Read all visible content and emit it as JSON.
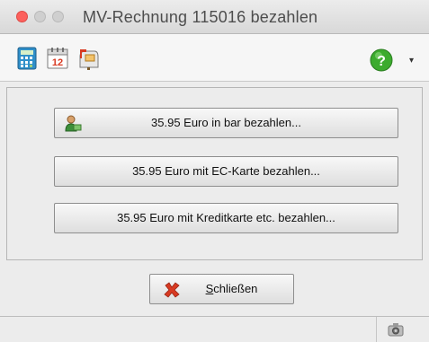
{
  "window": {
    "title": "MV-Rechnung 115016 bezahlen"
  },
  "toolbar": {
    "icons": [
      "calculator-icon",
      "calendar-icon",
      "mailbox-icon",
      "help-icon"
    ],
    "calendar_day": "12",
    "help_glyph": "?",
    "dropdown_glyph": "▾"
  },
  "payment": {
    "cash_label": "35.95 Euro in bar bezahlen...",
    "ec_label": "35.95 Euro mit EC-Karte bezahlen...",
    "credit_label": "35.95 Euro mit Kreditkarte etc. bezahlen..."
  },
  "footer": {
    "close_label_mnemonic": "S",
    "close_label_rest": "chließen"
  },
  "colors": {
    "help_green": "#3cab2e",
    "close_red": "#d83a22",
    "traffic_close": "#fc605c"
  }
}
